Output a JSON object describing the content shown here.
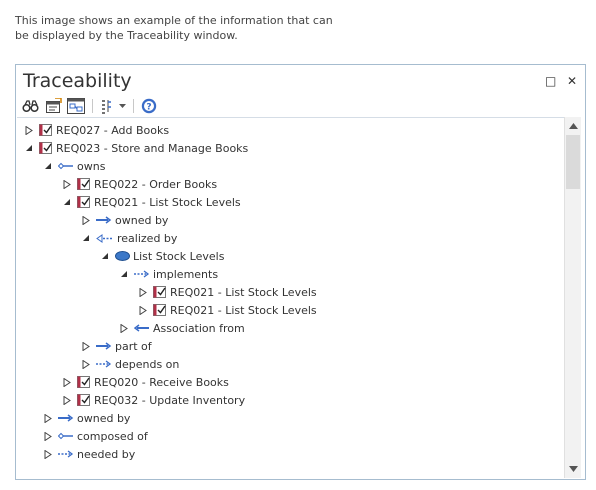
{
  "caption": {
    "line1": "This image shows an example of the information that can",
    "line2": "be displayed by the Traceability window."
  },
  "window": {
    "title": "Traceability",
    "maximize_glyph": "□",
    "close_glyph": "✕"
  },
  "toolbar": {
    "icons": [
      "binoculars-icon",
      "properties-icon",
      "browser-icon",
      "options-icon",
      "dropdown-icon",
      "help-icon"
    ]
  },
  "tree": {
    "expanded_symbol": "◢",
    "collapsed_symbol": "▷",
    "rows": [
      {
        "label": "REQ027 - Add Books",
        "level": 0,
        "state": "collapsed",
        "icon": "requirement"
      },
      {
        "label": "REQ023 - Store and Manage Books",
        "level": 0,
        "state": "expanded",
        "icon": "requirement"
      },
      {
        "label": "owns",
        "level": 1,
        "state": "expanded",
        "icon": "aggregation-arrow"
      },
      {
        "label": "REQ022 - Order Books",
        "level": 2,
        "state": "collapsed",
        "icon": "requirement"
      },
      {
        "label": "REQ021 - List Stock Levels",
        "level": 2,
        "state": "expanded",
        "icon": "requirement"
      },
      {
        "label": "owned by",
        "level": 3,
        "state": "collapsed",
        "icon": "association-arrow"
      },
      {
        "label": "realized by",
        "level": 3,
        "state": "expanded",
        "icon": "realization-arrow"
      },
      {
        "label": "List Stock Levels",
        "level": 4,
        "state": "expanded",
        "icon": "use-case"
      },
      {
        "label": "implements",
        "level": 5,
        "state": "expanded",
        "icon": "dependency-arrow"
      },
      {
        "label": "REQ021 - List Stock Levels",
        "level": 6,
        "state": "collapsed",
        "icon": "requirement"
      },
      {
        "label": "REQ021 - List Stock Levels",
        "level": 6,
        "state": "collapsed",
        "icon": "requirement"
      },
      {
        "label": "Association from",
        "level": 5,
        "state": "collapsed",
        "icon": "association-back-arrow"
      },
      {
        "label": "part of",
        "level": 3,
        "state": "collapsed",
        "icon": "association-arrow"
      },
      {
        "label": "depends on",
        "level": 3,
        "state": "collapsed",
        "icon": "dependency-arrow"
      },
      {
        "label": "REQ020 - Receive Books",
        "level": 2,
        "state": "collapsed",
        "icon": "requirement"
      },
      {
        "label": "REQ032 - Update Inventory",
        "level": 2,
        "state": "collapsed",
        "icon": "requirement"
      },
      {
        "label": "owned by",
        "level": 1,
        "state": "collapsed",
        "icon": "association-arrow"
      },
      {
        "label": "composed of",
        "level": 1,
        "state": "collapsed",
        "icon": "aggregation-arrow"
      },
      {
        "label": "needed by",
        "level": 1,
        "state": "collapsed",
        "icon": "dependency-arrow"
      }
    ]
  },
  "colors": {
    "window_border": "#a6bccf",
    "arrow_blue": "#3a6cc8",
    "requirement_red": "#b03048",
    "use_case_fill": "#3c78c8"
  }
}
